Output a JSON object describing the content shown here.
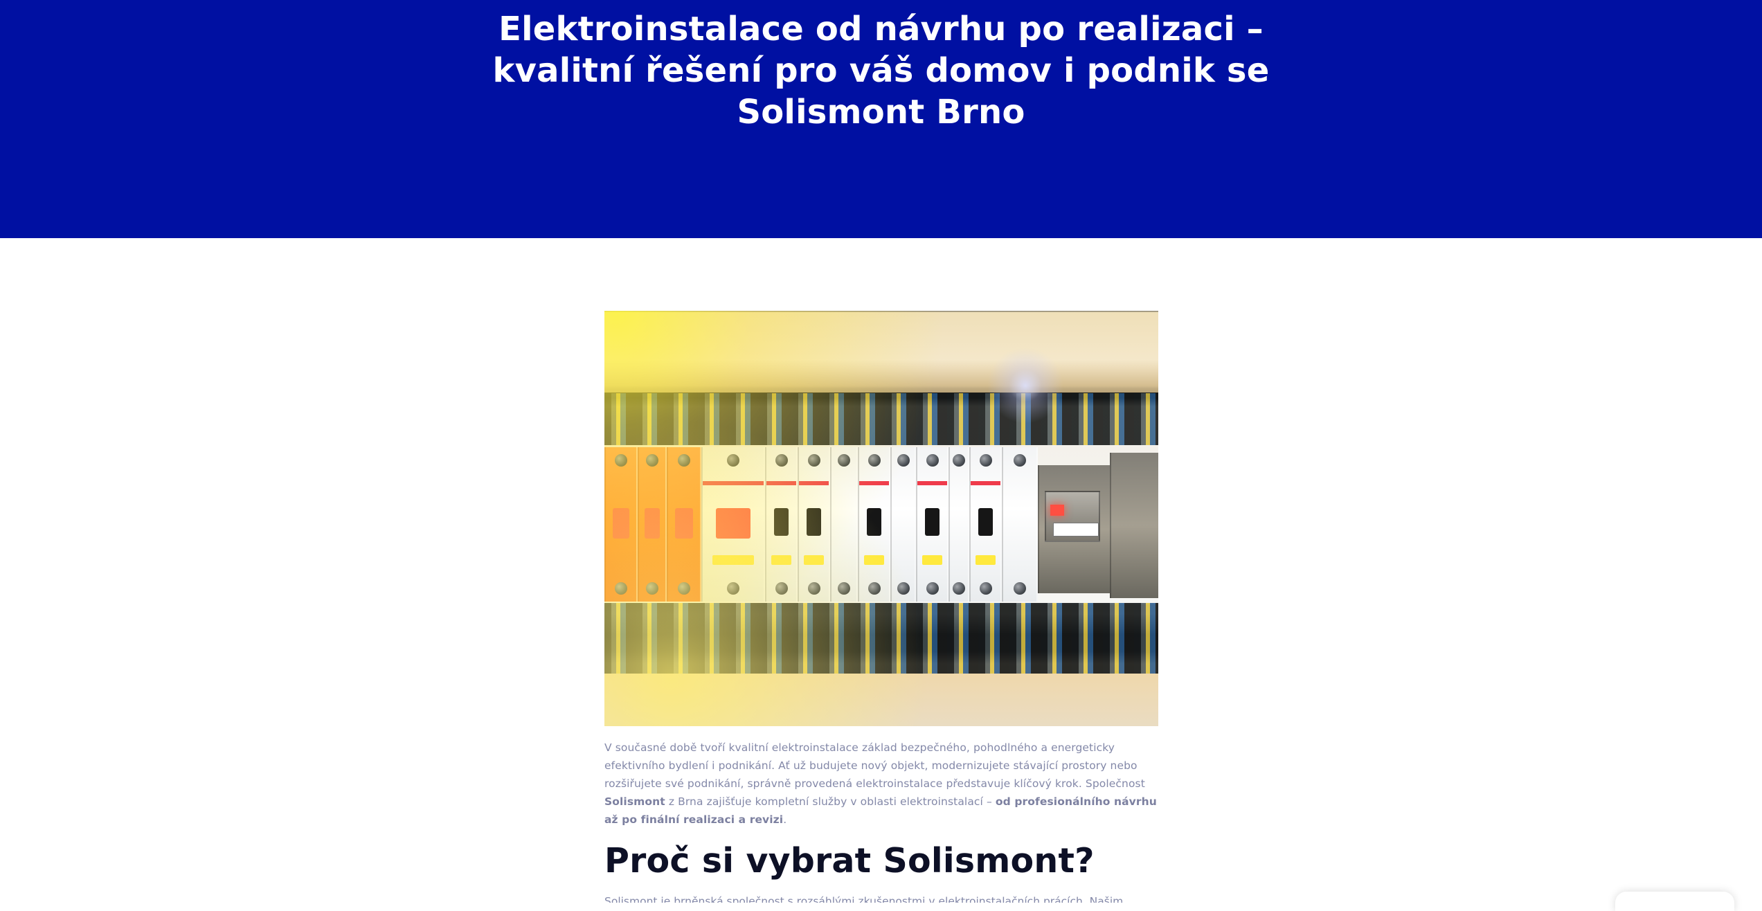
{
  "hero": {
    "title": "Elektroinstalace od návrhu po realizaci – kvalitní řešení pro váš domov i podnik se Solismont Brno",
    "background_color": "#0010a2"
  },
  "article": {
    "image": {
      "semantic": "electrical-distribution-board-photo"
    },
    "intro": {
      "part1": "V současné době tvoří kvalitní elektroinstalace základ bezpečného, pohodlného a energeticky efektivního bydlení i podnikání. Ať už budujete nový objekt, modernizujete stávající prostory nebo rozšiřujete své podnikání, správně provedená elektroinstalace představuje klíčový krok. Společnost",
      "brand": "Solismont",
      "part2": "z Brna zajišťuje kompletní služby v oblasti elektroinstalací –",
      "highlight": "od profesionálního návrhu až po finální realizaci a revizi",
      "end": "."
    },
    "section_title": "Proč si vybrat Solismont?",
    "next_paragraph_partial": "Solismont je brněnská společnost s rozsáhlými zkušenostmi v elektroinstalačních prácích. Našim"
  },
  "colors": {
    "text_primary": "#0d1026",
    "text_secondary": "#8388a8",
    "page_background": "#ffffff"
  }
}
